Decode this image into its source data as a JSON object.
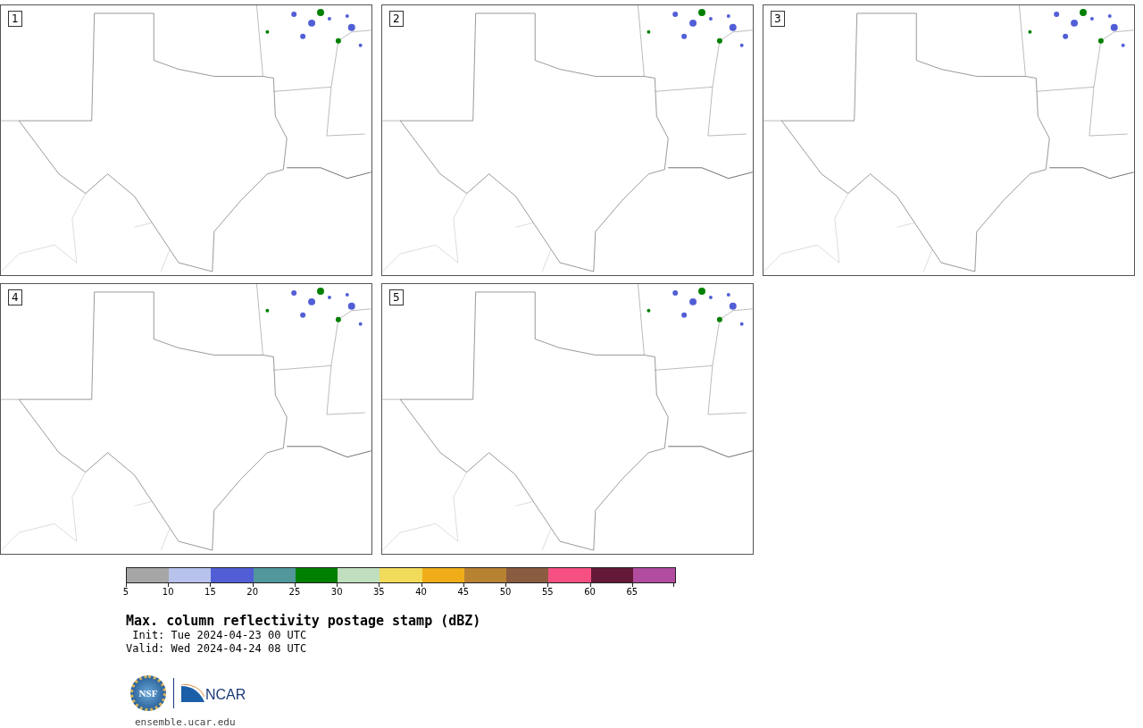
{
  "panels": [
    {
      "label": "1"
    },
    {
      "label": "2"
    },
    {
      "label": "3"
    },
    {
      "label": "4"
    },
    {
      "label": "5"
    }
  ],
  "colorbar": {
    "segments": [
      {
        "color": "#a6a6a6"
      },
      {
        "color": "#b8c2ec"
      },
      {
        "color": "#525ed6"
      },
      {
        "color": "#51979b"
      },
      {
        "color": "#008000"
      },
      {
        "color": "#bfdfbf"
      },
      {
        "color": "#f0db5b"
      },
      {
        "color": "#f0ad19"
      },
      {
        "color": "#b88233"
      },
      {
        "color": "#8a5c40"
      },
      {
        "color": "#f65082"
      },
      {
        "color": "#631937"
      },
      {
        "color": "#b14ca1"
      }
    ],
    "ticks": [
      "5",
      "10",
      "15",
      "20",
      "25",
      "30",
      "35",
      "40",
      "45",
      "50",
      "55",
      "60",
      "65"
    ]
  },
  "title": "Max. column reflectivity postage stamp (dBZ)",
  "init": " Init: Tue 2024-04-23 00 UTC",
  "valid": "Valid: Wed 2024-04-24 08 UTC",
  "logos": {
    "nsf": "NSF",
    "ncar": "NCAR"
  },
  "footer": "ensemble.ucar.edu"
}
